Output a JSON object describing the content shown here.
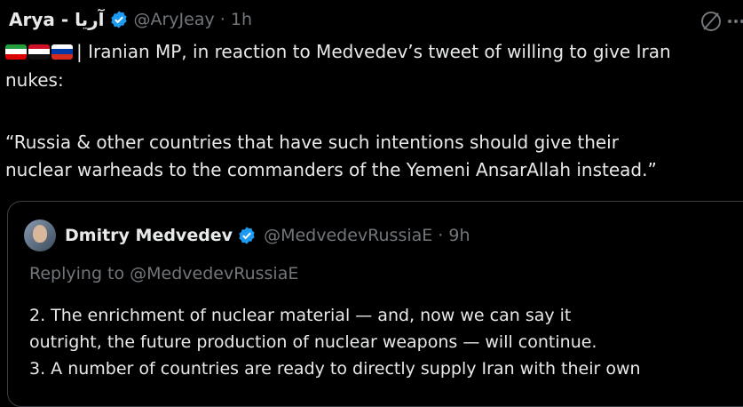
{
  "tweet": {
    "author_name": "Arya - آریا",
    "handle": "@AryJeay",
    "time": "1h",
    "line1": "| Iranian MP, in reaction to Medvedev’s tweet of willing to give Iran",
    "line2": "nukes:",
    "quote_lines": [
      "“Russia & other countries that have such intentions should give their",
      "nuclear warheads to the commanders of the Yemeni AnsarAllah instead.”"
    ],
    "flags": [
      "iran-flag",
      "yemen-flag",
      "russia-flag"
    ]
  },
  "quoted_tweet": {
    "author_name": "Dmitry Medvedev",
    "handle": "@MedvedevRussiaE",
    "time": "9h",
    "replying_to": "Replying to @MedvedevRussiaE",
    "body_lines": [
      "2. The enrichment of nuclear material — and, now we can say it",
      "outright, the future production of nuclear weapons — will continue.",
      "3. A number of countries are ready to directly supply Iran with their own"
    ]
  },
  "colors": {
    "verified": "#1d9bf0",
    "muted": "#71767b",
    "text": "#e7e9ea",
    "background": "#000000"
  }
}
